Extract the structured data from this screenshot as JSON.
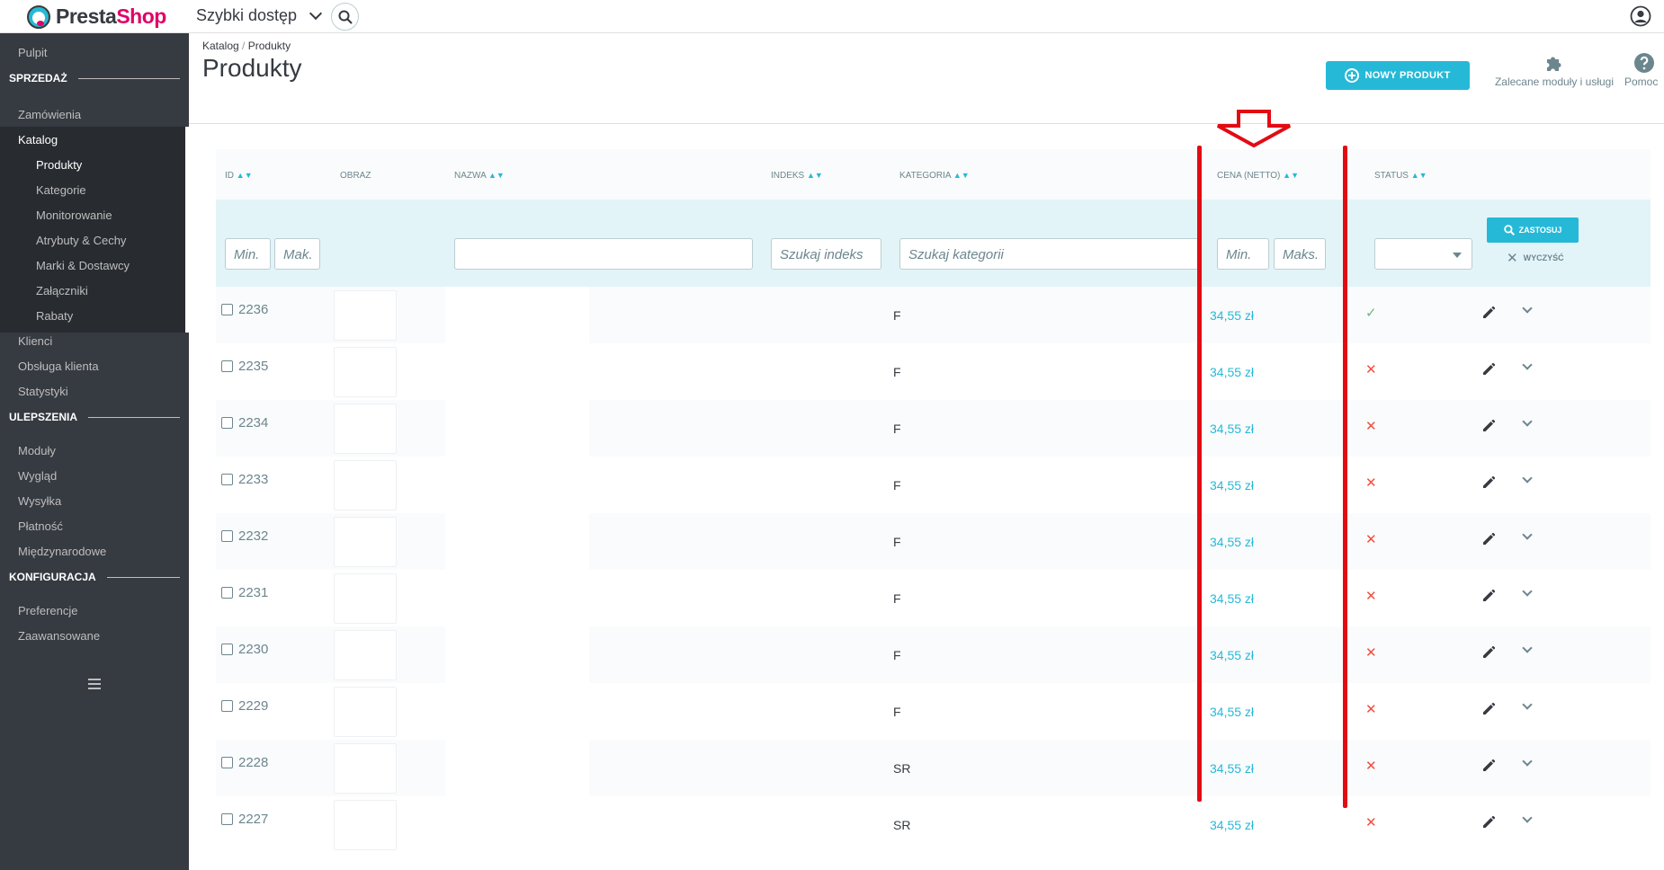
{
  "header": {
    "logo_presta": "Presta",
    "logo_shop": "Shop",
    "quick_access": "Szybki dostęp"
  },
  "sidebar": {
    "pulpit": "Pulpit",
    "sections": [
      "SPRZEDAŻ",
      "ULEPSZENIA",
      "KONFIGURACJA"
    ],
    "sales_items": [
      "Zamówienia",
      "Katalog"
    ],
    "catalog_sub": [
      "Produkty",
      "Kategorie",
      "Monitorowanie",
      "Atrybuty & Cechy",
      "Marki & Dostawcy",
      "Załączniki",
      "Rabaty"
    ],
    "sales_items_after": [
      "Klienci",
      "Obsługa klienta",
      "Statystyki"
    ],
    "improve_items": [
      "Moduły",
      "Wygląd",
      "Wysyłka",
      "Płatność",
      "Międzynarodowe"
    ],
    "config_items": [
      "Preferencje",
      "Zaawansowane"
    ]
  },
  "page": {
    "breadcrumb": [
      "Katalog",
      "Produkty"
    ],
    "breadcrumb_sep": "/",
    "title": "Produkty",
    "new_product": "NOWY PRODUKT",
    "recommended_modules": "Zalecane moduły i usługi",
    "help": "Pomoc"
  },
  "table": {
    "columns": {
      "id": "ID",
      "image": "OBRAZ",
      "name": "NAZWA",
      "index": "INDEKS",
      "category": "KATEGORIA",
      "price": "CENA (NETTO)",
      "status": "STATUS"
    },
    "sort_arrows": "▲▼",
    "filters": {
      "id_min": "Min.",
      "id_max": "Mak.",
      "index_placeholder": "Szukaj indeks",
      "category_placeholder": "Szukaj kategorii",
      "price_min": "Min.",
      "price_max": "Maks.",
      "apply": "ZASTOSUJ",
      "clear": "WYCZYŚĆ"
    },
    "rows": [
      {
        "id": "2236",
        "category": "F",
        "price": "34,55 zł",
        "status": "✓"
      },
      {
        "id": "2235",
        "category": "F",
        "price": "34,55 zł",
        "status": "✕"
      },
      {
        "id": "2234",
        "category": "F",
        "price": "34,55 zł",
        "status": "✕"
      },
      {
        "id": "2233",
        "category": "F",
        "price": "34,55 zł",
        "status": "✕"
      },
      {
        "id": "2232",
        "category": "F",
        "price": "34,55 zł",
        "status": "✕"
      },
      {
        "id": "2231",
        "category": "F",
        "price": "34,55 zł",
        "status": "✕"
      },
      {
        "id": "2230",
        "category": "F",
        "price": "34,55 zł",
        "status": "✕"
      },
      {
        "id": "2229",
        "category": "F",
        "price": "34,55 zł",
        "status": "✕"
      },
      {
        "id": "2228",
        "category": "SR",
        "price": "34,55 zł",
        "status": "✕"
      },
      {
        "id": "2227",
        "category": "SR",
        "price": "34,55 zł",
        "status": "✕"
      }
    ]
  },
  "colors": {
    "accent": "#25b9d7",
    "sidebar": "#363a41",
    "status_on": "#70b580",
    "status_off": "#f54c3e",
    "annotation": "#e30b13"
  }
}
